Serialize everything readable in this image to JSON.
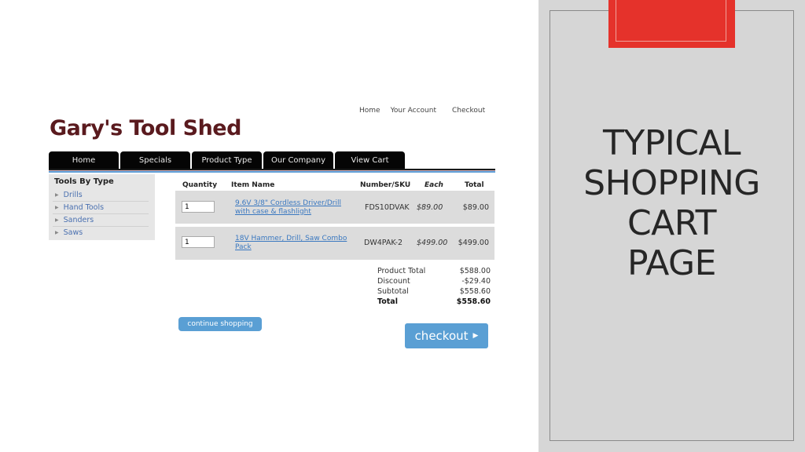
{
  "site": {
    "top_links": [
      "Home",
      "Your Account",
      "Checkout"
    ],
    "logo": "Gary's Tool Shed",
    "nav_tabs": [
      "Home",
      "Specials",
      "Product Type",
      "Our Company",
      "View Cart"
    ],
    "sidebar": {
      "title": "Tools By Type",
      "items": [
        "Drills",
        "Hand Tools",
        "Sanders",
        "Saws"
      ]
    },
    "cart": {
      "headers": {
        "quantity": "Quantity",
        "item_name": "Item Name",
        "sku": "Number/SKU",
        "each": "Each",
        "total": "Total"
      },
      "rows": [
        {
          "quantity": "1",
          "name": "9.6V 3/8\" Cordless Driver/Drill with case & flashlight",
          "sku": "FDS10DVAK",
          "each": "$89.00",
          "total": "$89.00"
        },
        {
          "quantity": "1",
          "name": "18V Hammer, Drill, Saw Combo Pack",
          "sku": "DW4PAK-2",
          "each": "$499.00",
          "total": "$499.00"
        }
      ],
      "summary": [
        {
          "label": "Product Total",
          "value": "$588.00"
        },
        {
          "label": "Discount",
          "value": "-$29.40"
        },
        {
          "label": "Subtotal",
          "value": "$558.60"
        },
        {
          "label": "Total",
          "value": "$558.60"
        }
      ]
    },
    "continue_label": "continue shopping",
    "checkout_label": "checkout",
    "checkout_arrow": "▶"
  },
  "slide": {
    "title_lines": [
      "TYPICAL",
      "SHOPPING",
      "CART",
      "PAGE"
    ],
    "accent_color": "#e5322b",
    "panel_color": "#d6d6d6"
  }
}
